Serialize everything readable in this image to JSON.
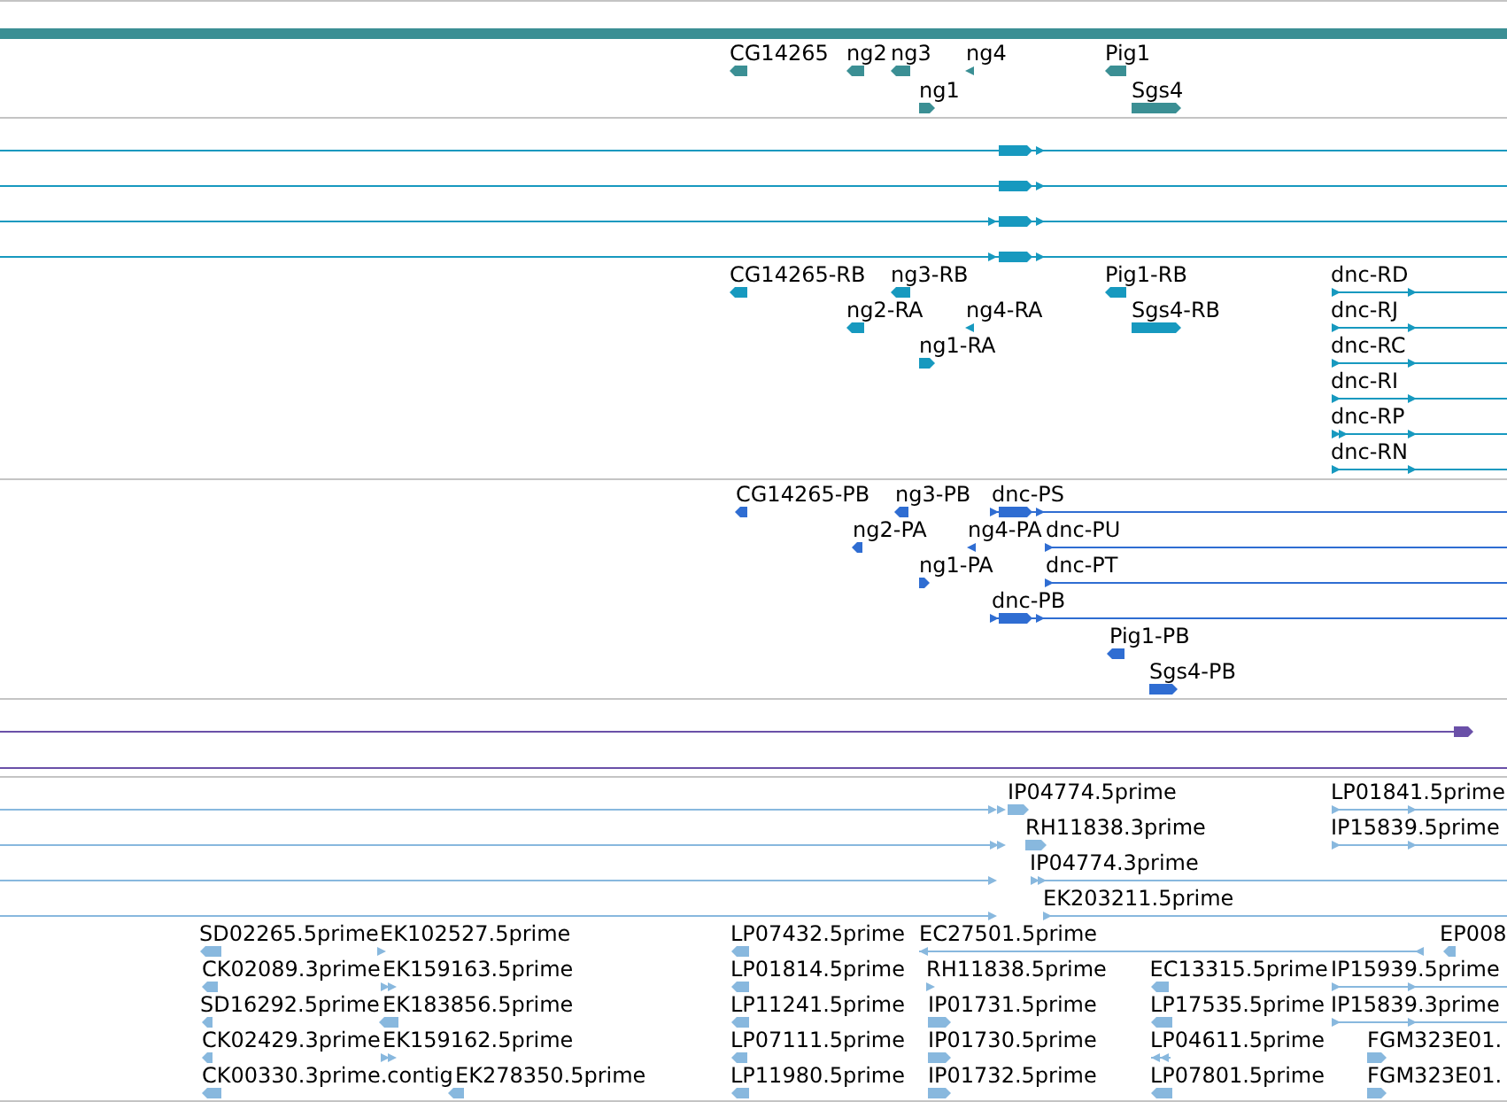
{
  "tracks": [
    {
      "kind": "gene",
      "features": [
        {
          "label": "CG14265",
          "reverse": true
        },
        {
          "label": "ng2",
          "reverse": true
        },
        {
          "label": "ng3",
          "reverse": true
        },
        {
          "label": "ng4",
          "reverse": true
        },
        {
          "label": "Pig1",
          "reverse": true
        },
        {
          "label": "ng1",
          "reverse": false
        },
        {
          "label": "Sgs4",
          "reverse": false
        }
      ]
    },
    {
      "kind": "mrna",
      "features": [
        {
          "reverse": false
        },
        {
          "reverse": false
        },
        {
          "reverse": false
        },
        {
          "reverse": false
        },
        {
          "label": "CG14265-RB",
          "reverse": true
        },
        {
          "label": "ng3-RB",
          "reverse": true
        },
        {
          "label": "Pig1-RB",
          "reverse": true
        },
        {
          "label": "dnc-RD",
          "reverse": false
        },
        {
          "label": "ng2-RA",
          "reverse": true
        },
        {
          "label": "ng4-RA",
          "reverse": true
        },
        {
          "label": "Sgs4-RB",
          "reverse": false
        },
        {
          "label": "dnc-RJ",
          "reverse": false
        },
        {
          "label": "ng1-RA",
          "reverse": false
        },
        {
          "label": "dnc-RC",
          "reverse": false
        },
        {
          "label": "dnc-RI",
          "reverse": false
        },
        {
          "label": "dnc-RP",
          "reverse": false
        },
        {
          "label": "dnc-RN",
          "reverse": false
        }
      ]
    },
    {
      "kind": "cds",
      "features": [
        {
          "label": "CG14265-PB",
          "reverse": true
        },
        {
          "label": "ng3-PB",
          "reverse": true
        },
        {
          "label": "dnc-PS",
          "reverse": false
        },
        {
          "label": "ng2-PA",
          "reverse": true
        },
        {
          "label": "ng4-PA",
          "reverse": true
        },
        {
          "label": "dnc-PU",
          "reverse": false
        },
        {
          "label": "ng1-PA",
          "reverse": false
        },
        {
          "label": "dnc-PT",
          "reverse": false
        },
        {
          "label": "dnc-PB",
          "reverse": false
        },
        {
          "label": "Pig1-PB",
          "reverse": true
        },
        {
          "label": "Sgs4-PB",
          "reverse": false
        }
      ]
    },
    {
      "kind": "match",
      "features": [
        {
          "reverse": false
        }
      ]
    },
    {
      "kind": "est",
      "features": [
        {
          "reverse": false
        },
        {
          "label": "IP04774.5prime",
          "reverse": false
        },
        {
          "label": "LP01841.5prime",
          "reverse": false
        },
        {
          "reverse": false
        },
        {
          "label": "RH11838.3prime",
          "reverse": false
        },
        {
          "label": "IP15839.5prime",
          "reverse": false
        },
        {
          "reverse": false
        },
        {
          "label": "IP04774.3prime",
          "reverse": false
        },
        {
          "reverse": false
        },
        {
          "label": "EK203211.5prime",
          "reverse": false
        },
        {
          "label": "SD02265.5prime",
          "reverse": true
        },
        {
          "label": "EK102527.5prime",
          "reverse": false
        },
        {
          "label": "LP07432.5prime",
          "reverse": true
        },
        {
          "label": "EC27501.5prime",
          "reverse": true
        },
        {
          "label": "EP008",
          "reverse": true
        },
        {
          "label": "CK02089.3prime",
          "reverse": true
        },
        {
          "label": "EK159163.5prime",
          "reverse": false
        },
        {
          "label": "LP01814.5prime",
          "reverse": true
        },
        {
          "label": "RH11838.5prime",
          "reverse": false
        },
        {
          "label": "EC13315.5prime",
          "reverse": true
        },
        {
          "label": "IP15939.5prime",
          "reverse": false
        },
        {
          "label": "SD16292.5prime",
          "reverse": true
        },
        {
          "label": "EK183856.5prime",
          "reverse": true
        },
        {
          "label": "LP11241.5prime",
          "reverse": true
        },
        {
          "label": "IP01731.5prime",
          "reverse": false
        },
        {
          "label": "LP17535.5prime",
          "reverse": true
        },
        {
          "label": "IP15839.3prime",
          "reverse": false
        },
        {
          "label": "CK02429.3prime",
          "reverse": true
        },
        {
          "label": "EK159162.5prime",
          "reverse": false
        },
        {
          "label": "LP07111.5prime",
          "reverse": true
        },
        {
          "label": "IP01730.5prime",
          "reverse": false
        },
        {
          "label": "LP04611.5prime",
          "reverse": true
        },
        {
          "label": "FGM323E01.",
          "reverse": false
        },
        {
          "label": "CK00330.3prime.contig",
          "reverse": true
        },
        {
          "label": "EK278350.5prime",
          "reverse": true
        },
        {
          "label": "LP11980.5prime",
          "reverse": true
        },
        {
          "label": "IP01732.5prime",
          "reverse": false
        },
        {
          "label": "LP07801.5prime",
          "reverse": true
        },
        {
          "label": "FGM323E01.",
          "reverse": false
        }
      ]
    }
  ]
}
